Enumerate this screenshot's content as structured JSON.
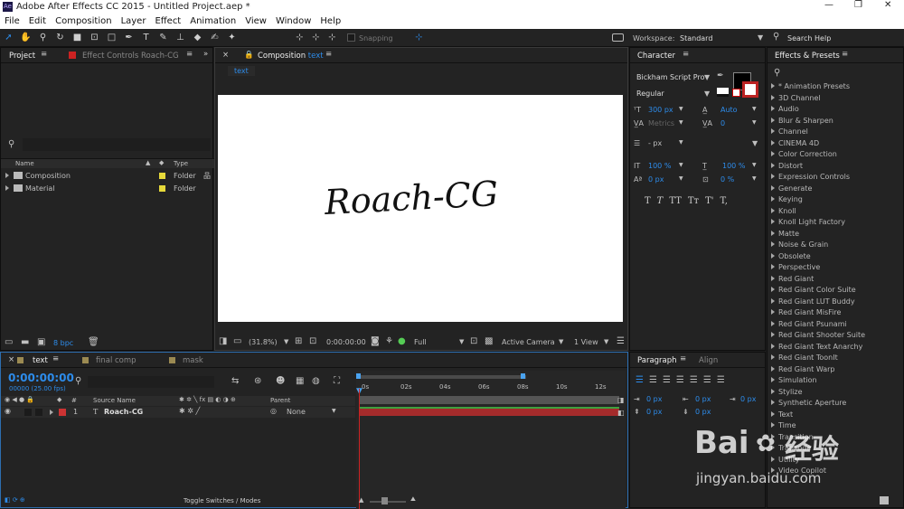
{
  "window": {
    "title": "Adobe After Effects CC 2015 - Untitled Project.aep *"
  },
  "menu": [
    "File",
    "Edit",
    "Composition",
    "Layer",
    "Effect",
    "Animation",
    "View",
    "Window",
    "Help"
  ],
  "toolbar": {
    "snapping": "Snapping",
    "workspace_label": "Workspace:",
    "workspace_value": "Standard",
    "search_help": "Search Help"
  },
  "project": {
    "tab": "Project",
    "effect_tab": "Effect Controls Roach-CG",
    "col_name": "Name",
    "col_type": "Type",
    "items": [
      {
        "name": "Composition",
        "type": "Folder"
      },
      {
        "name": "Material",
        "type": "Folder"
      }
    ],
    "bpc": "8 bpc"
  },
  "composition": {
    "tab_prefix": "Composition",
    "tab_name": "text",
    "flow": "text",
    "canvas_text": "Roach-CG",
    "zoom": "(31.8%)",
    "timecode": "0:00:00:00",
    "resolution": "Full",
    "camera": "Active Camera",
    "view": "1 View"
  },
  "character": {
    "tab": "Character",
    "font": "Bickham Script Pro",
    "style": "Regular",
    "size": "300 px",
    "leading": "Auto",
    "kerning": "Metrics",
    "tracking": "0",
    "stroke": "- px",
    "vscale": "100 %",
    "hscale": "100 %",
    "baseline": "0 px",
    "tsume": "0 %",
    "styles": [
      "T",
      "T",
      "TT",
      "Tт",
      "T'",
      "T,"
    ]
  },
  "paragraph": {
    "tab": "Paragraph",
    "align_tab": "Align",
    "indent_vals": [
      "0 px",
      "0 px",
      "0 px",
      "0 px",
      "0 px"
    ]
  },
  "effects": {
    "tab": "Effects & Presets",
    "items": [
      "* Animation Presets",
      "3D Channel",
      "Audio",
      "Blur & Sharpen",
      "Channel",
      "CINEMA 4D",
      "Color Correction",
      "Distort",
      "Expression Controls",
      "Generate",
      "Keying",
      "Knoll",
      "Knoll Light Factory",
      "Matte",
      "Noise & Grain",
      "Obsolete",
      "Perspective",
      "Red Giant",
      "Red Giant Color Suite",
      "Red Giant LUT Buddy",
      "Red Giant MisFire",
      "Red Giant Psunami",
      "Red Giant Shooter Suite",
      "Red Giant Text Anarchy",
      "Red Giant ToonIt",
      "Red Giant Warp",
      "Simulation",
      "Stylize",
      "Synthetic Aperture",
      "Text",
      "Time",
      "Transition",
      "Trapcode",
      "Utility",
      "Video Copilot"
    ]
  },
  "timeline": {
    "tabs": [
      "text",
      "final comp",
      "mask"
    ],
    "timecode": "0:00:00:00",
    "frames": "00000 (25.00 fps)",
    "col_source": "Source Name",
    "col_parent": "Parent",
    "layer": {
      "num": "1",
      "name": "Roach-CG",
      "parent": "None"
    },
    "ruler": [
      "0s",
      "02s",
      "04s",
      "06s",
      "08s",
      "10s",
      "12s"
    ],
    "toggle": "Toggle Switches / Modes"
  },
  "watermark": {
    "line1": "Bai",
    "line2": "经验",
    "url": "jingyan.baidu.com"
  }
}
